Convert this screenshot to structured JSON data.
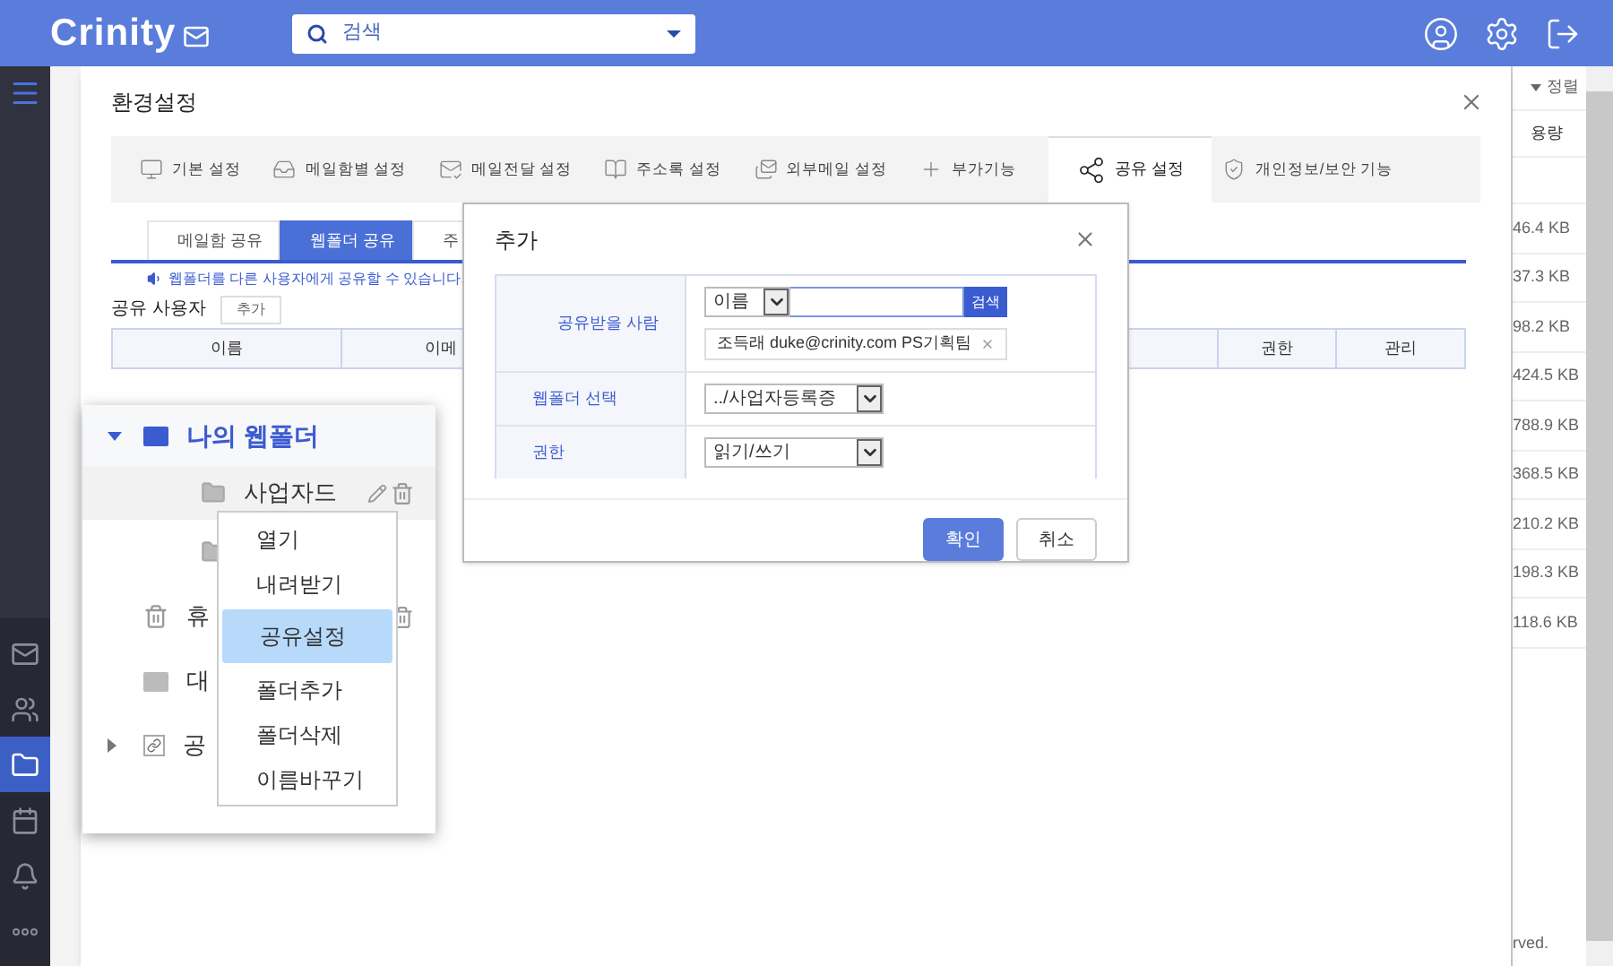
{
  "header": {
    "logo": "Crinity",
    "search": {
      "placeholder": "검색"
    }
  },
  "sidebar": {
    "items": [
      {
        "kind": "mail",
        "selected": false
      },
      {
        "kind": "people",
        "selected": false
      },
      {
        "kind": "folder",
        "selected": true
      },
      {
        "kind": "calendar",
        "selected": false
      },
      {
        "kind": "bell",
        "selected": false
      },
      {
        "kind": "more",
        "selected": false
      }
    ]
  },
  "file_list": {
    "sort_label": "정렬",
    "column": "용량",
    "rows": [
      "46.4 KB",
      "37.3 KB",
      "98.2 KB",
      "424.5 KB",
      "788.9 KB",
      "368.5 KB",
      "210.2 KB",
      "198.3 KB",
      "118.6 KB"
    ],
    "footer": "rved."
  },
  "settings": {
    "title": "환경설정",
    "tabs": [
      {
        "label": "기본 설정",
        "kind": "monitor",
        "selected": false
      },
      {
        "label": "메일함별 설정",
        "kind": "mailbox",
        "selected": false
      },
      {
        "label": "메일전달 설정",
        "kind": "forward",
        "selected": false
      },
      {
        "label": "주소록 설정",
        "kind": "book",
        "selected": false
      },
      {
        "label": "외부메일 설정",
        "kind": "external",
        "selected": false
      },
      {
        "label": "부가기능",
        "kind": "plus",
        "selected": false
      },
      {
        "label": "공유 설정",
        "kind": "share",
        "selected": true
      },
      {
        "label": "개인정보/보안 기능",
        "kind": "shield",
        "selected": false
      }
    ],
    "subtabs": [
      {
        "label": "메일함 공유",
        "selected": false
      },
      {
        "label": "웹폴더 공유",
        "selected": true
      },
      {
        "label": "주",
        "selected": false
      }
    ],
    "notice": "웹폴더를 다른 사용자에게 공유할 수 있습니다.",
    "share_users_label": "공유 사용자",
    "add_button": "추가",
    "columns": [
      "이름",
      "이메",
      "권한",
      "관리"
    ]
  },
  "add_dialog": {
    "title": "추가",
    "rows": [
      {
        "kind": "recipient",
        "label": "공유받을 사람",
        "select": "이름",
        "search_button": "검색",
        "chip": "조득래 duke@crinity.com PS기획팀"
      },
      {
        "kind": "select",
        "label": "웹폴더 선택",
        "value": "../사업자등록증"
      },
      {
        "kind": "select",
        "label": "권한",
        "value": "읽기/쓰기"
      }
    ],
    "buttons": [
      {
        "label": "확인",
        "primary": true
      },
      {
        "label": "취소",
        "primary": false
      }
    ]
  },
  "folder_tree": {
    "items": [
      {
        "kind": "me",
        "label": "나의 웹폴더",
        "expanded": true,
        "children": [
          {
            "kind": "folder",
            "label": "사업자드",
            "hovered": true
          },
          {
            "kind": "folder",
            "hovered": false
          }
        ]
      },
      {
        "kind": "trash",
        "label": "휴",
        "hovered": false
      },
      {
        "kind": "big",
        "label": "대",
        "hovered": false
      },
      {
        "kind": "link",
        "label": "공",
        "expanded": false,
        "hovered": false
      }
    ]
  },
  "context_menu": {
    "items": [
      {
        "label": "열기",
        "selected": false
      },
      {
        "label": "내려받기",
        "selected": false
      },
      {
        "label": "공유설정",
        "selected": true
      },
      {
        "label": "폴더추가",
        "selected": false
      },
      {
        "label": "폴더삭제",
        "selected": false
      },
      {
        "label": "이름바꾸기",
        "selected": false
      }
    ]
  }
}
